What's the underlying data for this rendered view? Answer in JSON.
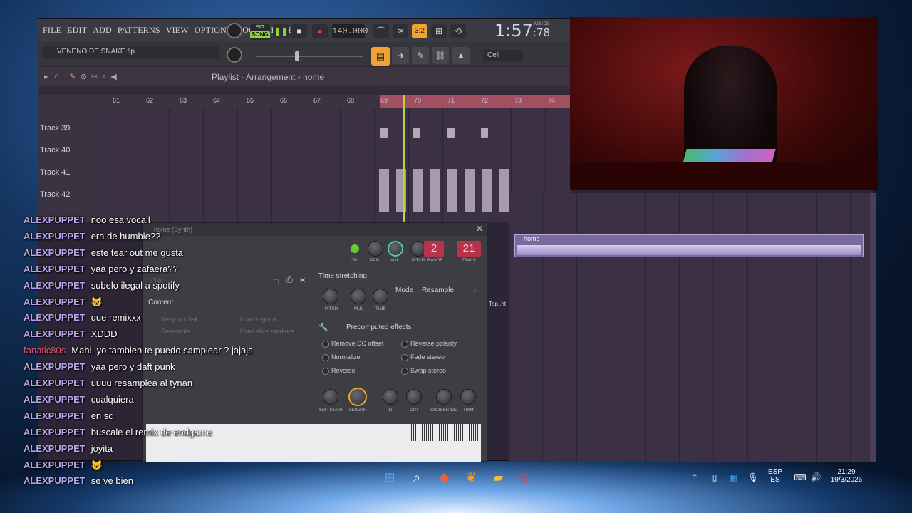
{
  "menu": [
    "FILE",
    "EDIT",
    "ADD",
    "PATTERNS",
    "VIEW",
    "OPTIONS",
    "TOOLS",
    "HELP"
  ],
  "toolbar": {
    "song_label": "SONG",
    "pat_label": "PAT",
    "tempo": "140.000",
    "time": "1:57",
    "time_small": ":78",
    "mcs": "M:S:CS",
    "snap": "Cell"
  },
  "project": {
    "filename": "VENENO DE SNAKE.flp"
  },
  "playlist": {
    "crumb": "Playlist - Arrangement",
    "crumb2": "home",
    "ruler": [
      "61",
      "62",
      "63",
      "64",
      "65",
      "66",
      "67",
      "68",
      "69",
      "70",
      "71",
      "72",
      "73",
      "74"
    ],
    "tracks": [
      "Track 39",
      "Track 40",
      "Track 41",
      "Track 42"
    ],
    "clip_name": "home"
  },
  "synth": {
    "title": "home (Synth)",
    "on": "ON",
    "pan": "PAN",
    "vol": "VOL",
    "pitch": "PITCH",
    "range": "RANGE",
    "track": "TRACK",
    "range_val": "2",
    "track_val": "21",
    "time_stretching": "Time stretching",
    "pitch2": "PITCH",
    "mul": "MUL",
    "time": "TIME",
    "mode_label": "Mode",
    "mode_val": "Resample",
    "file": "File",
    "content": "Content",
    "keep_on_disk": "Keep on disk",
    "resample": "Resample",
    "load_regions": "Load regions",
    "load_slice": "Load slice markers",
    "precomputed": "Precomputed effects",
    "effects": [
      "Remove DC offset",
      "Normalize",
      "Reverse",
      "Reverse polarity",
      "Fade stereo",
      "Swap stereo"
    ],
    "knobs": [
      "SMP START",
      "LENGTH",
      "IN",
      "OUT",
      "CROSSFADE",
      "TRIM"
    ],
    "side": "Top..ht"
  },
  "chat": [
    {
      "u": "ALEXPUPPET",
      "m": "noo esa vocall"
    },
    {
      "u": "ALEXPUPPET",
      "m": "era de humble??"
    },
    {
      "u": "ALEXPUPPET",
      "m": "este tear out me gusta"
    },
    {
      "u": "ALEXPUPPET",
      "m": "yaa pero y zafaera??"
    },
    {
      "u": "ALEXPUPPET",
      "m": "subelo ilegal a spotify"
    },
    {
      "u": "ALEXPUPPET",
      "m": "😺"
    },
    {
      "u": "ALEXPUPPET",
      "m": "que remixxx"
    },
    {
      "u": "ALEXPUPPET",
      "m": "XDDD"
    },
    {
      "u": "fanatic80s",
      "m": "Mahi, yo tambien te puedo samplear ? jajajs"
    },
    {
      "u": "ALEXPUPPET",
      "m": "yaa pero y daft punk"
    },
    {
      "u": "ALEXPUPPET",
      "m": "uuuu resamplea al tynan"
    },
    {
      "u": "ALEXPUPPET",
      "m": "cualquiera"
    },
    {
      "u": "ALEXPUPPET",
      "m": "en sc"
    },
    {
      "u": "ALEXPUPPET",
      "m": "buscale el remix de endgame"
    },
    {
      "u": "ALEXPUPPET",
      "m": "joyita"
    },
    {
      "u": "ALEXPUPPET",
      "m": "😺"
    },
    {
      "u": "ALEXPUPPET",
      "m": "se ve bien"
    }
  ],
  "tray": {
    "lang1": "ESP",
    "lang2": "ES",
    "time": "21:29",
    "date": "19/3/2026"
  },
  "colors": {
    "accent": "#f0a233",
    "chat_user": "#b9a6e8",
    "chat_user_alt": "#e8567a",
    "ruler_red": "#a24f62"
  }
}
